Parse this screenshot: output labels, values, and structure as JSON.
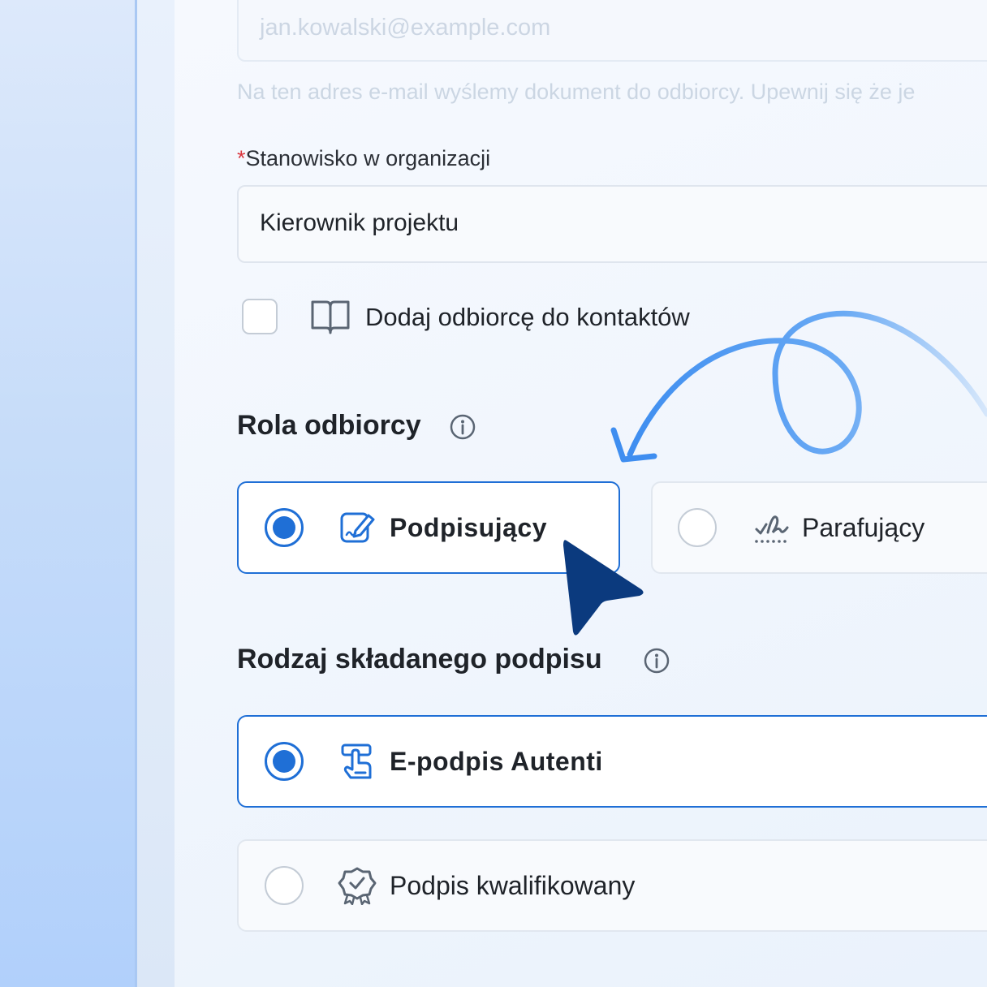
{
  "email": {
    "value": "jan.kowalski@example.com",
    "hint": "Na ten adres e-mail wyślemy dokument do odbiorcy. Upewnij się że je"
  },
  "position_field": {
    "required_mark": "*",
    "label": "Stanowisko w organizacji",
    "value": "Kierownik projektu"
  },
  "add_contact": {
    "label": "Dodaj odbiorcę do kontaktów",
    "checked": false,
    "icon": "book-icon"
  },
  "recipient_role": {
    "title": "Rola odbiorcy",
    "options": [
      {
        "label": "Podpisujący",
        "selected": true,
        "icon": "edit-signature-icon"
      },
      {
        "label": "Parafujący",
        "selected": false,
        "icon": "initials-icon"
      }
    ]
  },
  "signature_type": {
    "title": "Rodzaj składanego podpisu",
    "options": [
      {
        "label": "E-podpis Autenti",
        "selected": true,
        "icon": "touch-sign-icon"
      },
      {
        "label": "Podpis kwalifikowany",
        "selected": false,
        "icon": "certified-badge-icon"
      }
    ]
  },
  "colors": {
    "accent": "#1f6fd6",
    "cursor": "#0b3a7e",
    "swirl": "#5aa0f2"
  }
}
